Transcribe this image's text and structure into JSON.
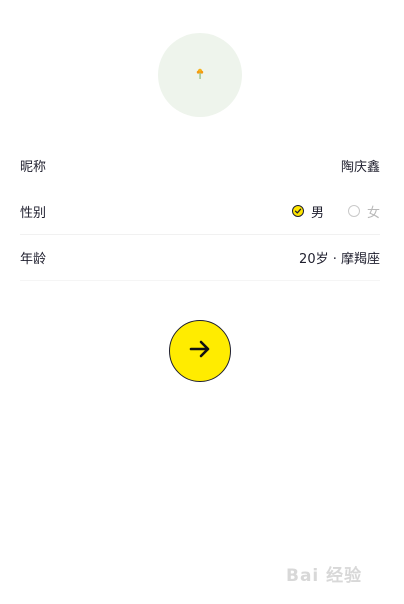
{
  "profile": {
    "avatar_icon": "flower-icon",
    "nickname_label": "昵称",
    "nickname_value": "陶庆鑫",
    "gender_label": "性别",
    "gender_options": [
      {
        "label": "男",
        "selected": true
      },
      {
        "label": "女",
        "selected": false
      }
    ],
    "age_label": "年龄",
    "age_value": "20岁 · 摩羯座"
  },
  "actions": {
    "next_icon": "arrow-right-icon"
  },
  "colors": {
    "accent": "#ffec00",
    "text": "#1f1f2e",
    "muted": "#b9b9b9",
    "avatar_bg": "#eef4ec"
  },
  "watermark": {
    "text": "Bai 经验"
  }
}
